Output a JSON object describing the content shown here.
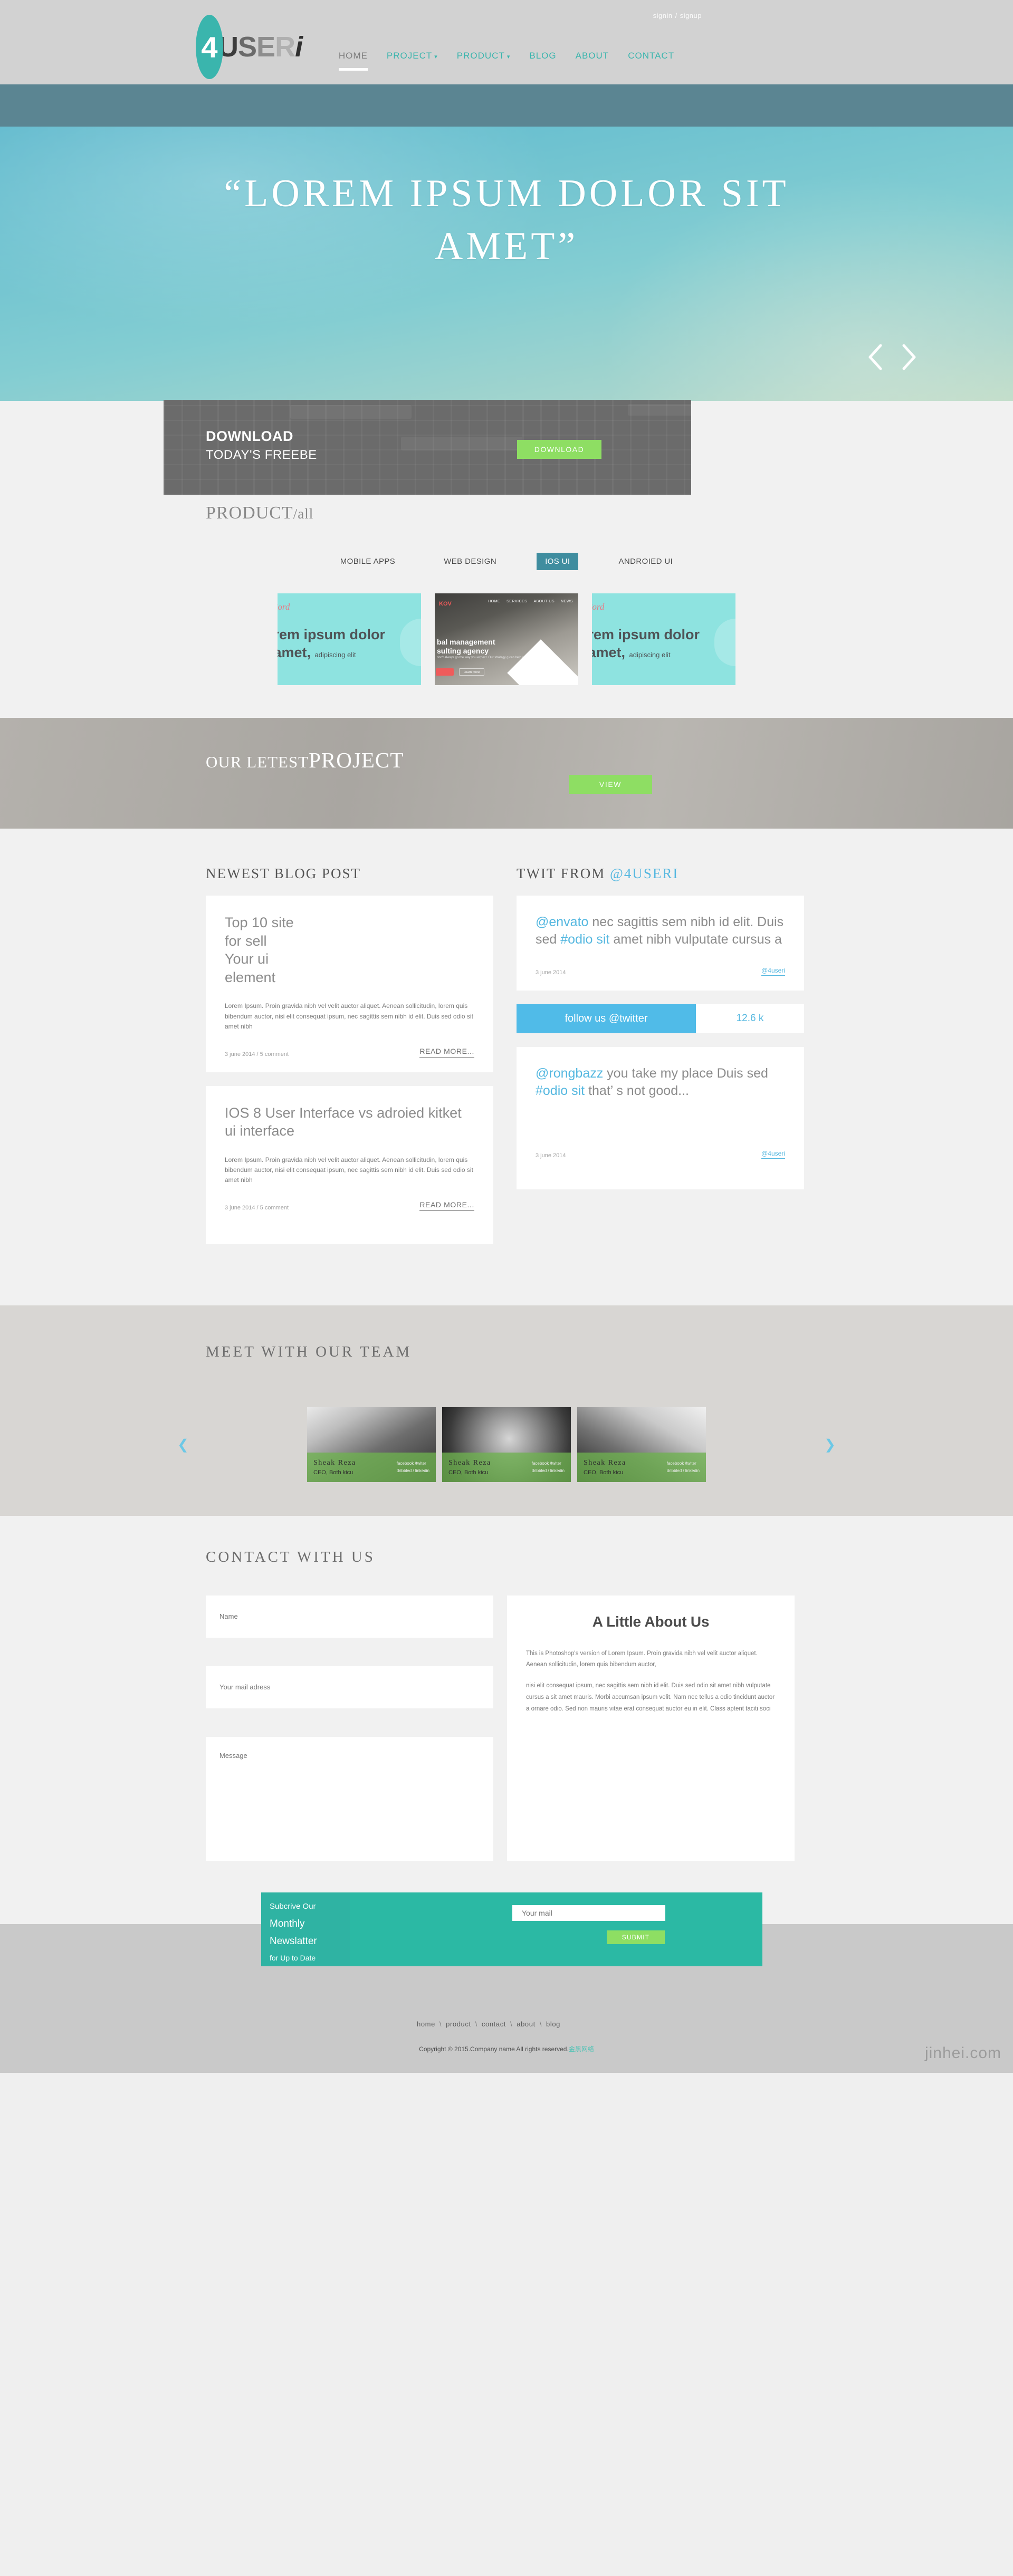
{
  "header": {
    "logo": {
      "mark": "4",
      "u": "U",
      "s": "S",
      "e": "E",
      "r": "R",
      "i": "i"
    },
    "auth": {
      "signin": "signin",
      "sep": "/",
      "signup": "signup"
    },
    "nav": [
      {
        "label": "HOME",
        "caret": "",
        "active": true
      },
      {
        "label": "PROJECT",
        "caret": "▾",
        "active": false
      },
      {
        "label": "PRODUCT",
        "caret": "▾",
        "active": false
      },
      {
        "label": "BLOG",
        "caret": "",
        "active": false
      },
      {
        "label": "ABOUT",
        "caret": "",
        "active": false
      },
      {
        "label": "CONTACT",
        "caret": "",
        "active": false
      }
    ]
  },
  "hero": {
    "line1": "“LOREM IPSUM DOLOR SIT",
    "line2": "AMET”",
    "prev_icon": "chevron-left-icon",
    "next_icon": "chevron-right-icon"
  },
  "download": {
    "title": "DOWNLOAD",
    "subtitle": "TODAY'S FREEBE",
    "button": "DOWNLOAD"
  },
  "product": {
    "title_main": "PRODUCT",
    "title_sub": "/all",
    "tabs": [
      {
        "label": "MOBILE APPS",
        "active": false
      },
      {
        "label": "WEB DESIGN",
        "active": false
      },
      {
        "label": "IOS UI",
        "active": true
      },
      {
        "label": "ANDROIED UI",
        "active": false
      }
    ],
    "cards": [
      {
        "brand": "Ford",
        "headline": "orem ipsum dolor",
        "headline2": "t amet,",
        "small": "adipiscing elit"
      },
      {
        "brand": "KOV",
        "nav": [
          "HOME",
          "SERVICES",
          "ABOUT US",
          "NEWS"
        ],
        "headline": "bal management",
        "headline2": "sulting agency",
        "sub": "don't  always go the way you expect. Our strategy\ng can help you climb.",
        "btn1": "",
        "btn2": "Learn more"
      },
      {
        "brand": "Ford",
        "headline": "orem ipsum dolor",
        "headline2": "t amet,",
        "small": "adipiscing elit"
      }
    ]
  },
  "latest": {
    "small": "OUR LETEST",
    "big": "PROJECT",
    "button": "VIEW"
  },
  "blog": {
    "heading": "NEWEST BLOG POST",
    "posts": [
      {
        "title": "Top 10 site\nfor sell\nYour ui\nelement",
        "body": "Lorem Ipsum. Proin gravida nibh vel velit auctor aliquet. Aenean sollicitudin, lorem quis bibendum auctor, nisi elit consequat ipsum, nec sagittis sem nibh id elit. Duis sed odio sit amet nibh",
        "meta": "3 june 2014 / 5 comment",
        "more": "READ MORE..."
      },
      {
        "title": "IOS 8 User Interface vs adroied kitket ui interface",
        "body": "Lorem Ipsum. Proin gravida nibh vel velit auctor aliquet. Aenean sollicitudin, lorem quis bibendum auctor, nisi elit consequat ipsum, nec sagittis sem nibh id elit. Duis sed odio sit amet nibh",
        "meta": "3 june 2014 / 5 comment",
        "more": "READ MORE..."
      }
    ]
  },
  "twitter": {
    "heading_plain": "TWIT FROM ",
    "heading_handle": "@4USERI",
    "tweets": [
      {
        "mention": "@envato",
        "text_a": " nec sagittis sem nibh id elit. Duis sed ",
        "tag": "#odio sit",
        "text_b": " amet nibh vulputate cursus a",
        "date": "3 june 2014",
        "handle": "@4useri"
      },
      {
        "mention": "@rongbazz",
        "text_a": " you take my place Duis sed ",
        "tag": "#odio sit",
        "text_b": " that’ s not good...",
        "date": "3 june 2014",
        "handle": "@4useri"
      }
    ],
    "follow_label": "follow us @twitter",
    "follow_count": "12.6 k"
  },
  "team": {
    "heading": "MEET WITH OUR TEAM",
    "prev_icon": "chevron-left-icon",
    "next_icon": "chevron-right-icon",
    "members": [
      {
        "name": "Sheak Reza",
        "role": "CEO, Both kicu",
        "social1": "facebook /twiter",
        "social2": "dribbled / linkedin"
      },
      {
        "name": "Sheak Reza",
        "role": "CEO, Both kicu",
        "social1": "facebook /twiter",
        "social2": "dribbled / linkedin"
      },
      {
        "name": "Sheak Reza",
        "role": "CEO, Both kicu",
        "social1": "facebook /twiter",
        "social2": "dribbled / linkedin"
      }
    ]
  },
  "contact": {
    "heading": "CONTACT WITH US",
    "name_placeholder": "Name",
    "mail_placeholder": "Your mail adress",
    "message_placeholder": "Message",
    "about_title": "A Little About Us",
    "about_p1": "This is Photoshop's version of Lorem Ipsum. Proin gravida nibh vel velit auctor aliquet. Aenean sollicitudin, lorem quis bibendum auctor,",
    "about_p2": "nisi elit consequat ipsum, nec sagittis sem nibh id elit. Duis sed odio sit amet nibh vulputate cursus a sit amet mauris. Morbi accumsan ipsum velit. Nam nec tellus a odio tincidunt auctor a ornare odio. Sed non mauris vitae erat consequat auctor eu in elit. Class aptent taciti soci"
  },
  "newsletter": {
    "line1": "Subcrive Our",
    "line2": "Monthly",
    "line3": "Newslatter",
    "line4": "for Up to Date",
    "mail_placeholder": "Your mail",
    "submit": "SUBMIT"
  },
  "footer": {
    "links": [
      "home",
      "product",
      "contact",
      "about",
      "blog"
    ],
    "separator": "\\",
    "copyright_main": "Copyright © 2015.Company name All rights reserved.",
    "copyright_cn": "金黑网络",
    "watermark": "jinhei.com"
  },
  "colors": {
    "teal": "#3ab5ad",
    "green": "#8ede63",
    "blue": "#56b8e0",
    "tab_active": "#3f8d9f",
    "news_teal": "#2bb9a4"
  }
}
